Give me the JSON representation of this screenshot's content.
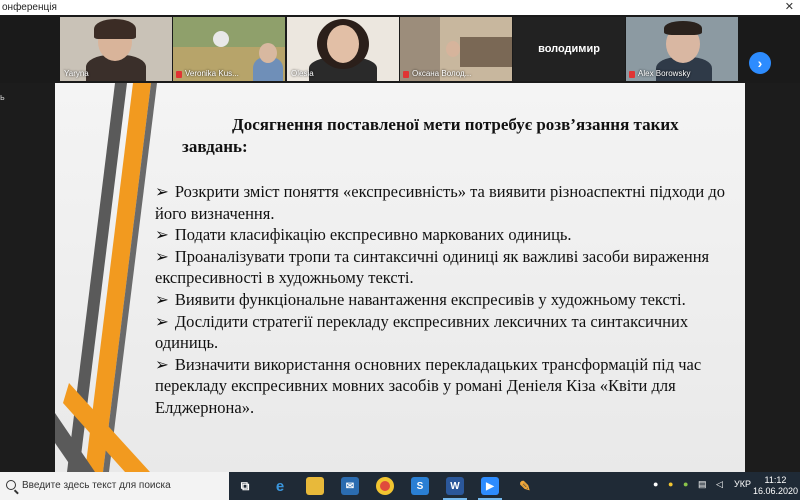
{
  "window": {
    "title": "онференція"
  },
  "participants": [
    {
      "name": "Yaryna",
      "muted": false
    },
    {
      "name": "Veronika Kus...",
      "muted": true
    },
    {
      "name": "Olesia",
      "muted": false
    },
    {
      "name": "Оксана Волод...",
      "muted": true
    },
    {
      "name": "володимир",
      "muted": false
    },
    {
      "name": "Alex Borowsky",
      "muted": true
    }
  ],
  "sidebar": {
    "mark": "ь"
  },
  "slide": {
    "title": "Досягнення поставленої мети потребує розв’язання таких завдань:",
    "bullet": "➢",
    "tasks": [
      "Розкрити зміст поняття «експресивність» та виявити різноаспектні підходи до його визначення.",
      "Подати класифікацію експресивно маркованих одиниць.",
      "Проаналізувати тропи та синтаксичні одиниці як важливі засоби вираження експресивності в художньому тексті.",
      "Виявити функціональне навантаження експресивів у художньому тексті.",
      "Дослідити стратегії перекладу експресивних лексичних та синтаксичних одиниць.",
      "Визначити використання основних перекладацьких трансформацій під час перекладу експресивних мовних засобів у романі Деніеля Кіза «Квіти для Елджернона»."
    ]
  },
  "taskbar": {
    "search_placeholder": "Введите здесь текст для поиска",
    "word_label": "W",
    "language": "УКР",
    "time": "11:12",
    "date": "16.06.2020"
  },
  "colors": {
    "accent": "#2d8cff",
    "slide_orange": "#f29a1f",
    "slide_gray": "#5a5a5a"
  }
}
